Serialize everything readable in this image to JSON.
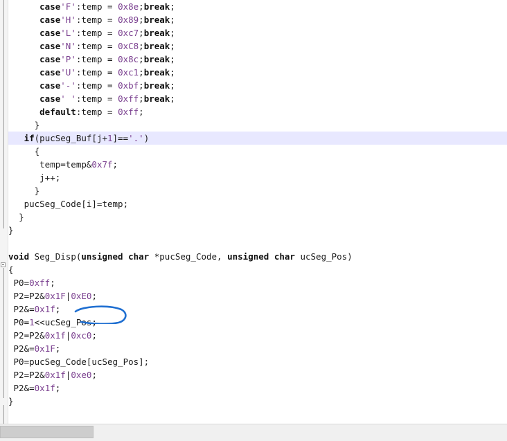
{
  "editor": {
    "lines": [
      {
        "indent": "      ",
        "parts": [
          [
            "k",
            "case"
          ],
          [
            "s",
            "'F'"
          ],
          [
            "t",
            ":temp = "
          ],
          [
            "n",
            "0x8e"
          ],
          [
            "t",
            ";"
          ],
          [
            "k",
            "break"
          ],
          [
            "t",
            ";"
          ]
        ]
      },
      {
        "indent": "      ",
        "parts": [
          [
            "k",
            "case"
          ],
          [
            "s",
            "'H'"
          ],
          [
            "t",
            ":temp = "
          ],
          [
            "n",
            "0x89"
          ],
          [
            "t",
            ";"
          ],
          [
            "k",
            "break"
          ],
          [
            "t",
            ";"
          ]
        ]
      },
      {
        "indent": "      ",
        "parts": [
          [
            "k",
            "case"
          ],
          [
            "s",
            "'L'"
          ],
          [
            "t",
            ":temp = "
          ],
          [
            "n",
            "0xc7"
          ],
          [
            "t",
            ";"
          ],
          [
            "k",
            "break"
          ],
          [
            "t",
            ";"
          ]
        ]
      },
      {
        "indent": "      ",
        "parts": [
          [
            "k",
            "case"
          ],
          [
            "s",
            "'N'"
          ],
          [
            "t",
            ":temp = "
          ],
          [
            "n",
            "0xC8"
          ],
          [
            "t",
            ";"
          ],
          [
            "k",
            "break"
          ],
          [
            "t",
            ";"
          ]
        ]
      },
      {
        "indent": "      ",
        "parts": [
          [
            "k",
            "case"
          ],
          [
            "s",
            "'P'"
          ],
          [
            "t",
            ":temp = "
          ],
          [
            "n",
            "0x8c"
          ],
          [
            "t",
            ";"
          ],
          [
            "k",
            "break"
          ],
          [
            "t",
            ";"
          ]
        ]
      },
      {
        "indent": "      ",
        "parts": [
          [
            "k",
            "case"
          ],
          [
            "s",
            "'U'"
          ],
          [
            "t",
            ":temp = "
          ],
          [
            "n",
            "0xc1"
          ],
          [
            "t",
            ";"
          ],
          [
            "k",
            "break"
          ],
          [
            "t",
            ";"
          ]
        ]
      },
      {
        "indent": "      ",
        "parts": [
          [
            "k",
            "case"
          ],
          [
            "s",
            "'-'"
          ],
          [
            "t",
            ":temp = "
          ],
          [
            "n",
            "0xbf"
          ],
          [
            "t",
            ";"
          ],
          [
            "k",
            "break"
          ],
          [
            "t",
            ";"
          ]
        ]
      },
      {
        "indent": "      ",
        "parts": [
          [
            "k",
            "case"
          ],
          [
            "s",
            "' '"
          ],
          [
            "t",
            ":temp = "
          ],
          [
            "n",
            "0xff"
          ],
          [
            "t",
            ";"
          ],
          [
            "k",
            "break"
          ],
          [
            "t",
            ";"
          ]
        ]
      },
      {
        "indent": "      ",
        "parts": [
          [
            "k",
            "default"
          ],
          [
            "t",
            ":temp = "
          ],
          [
            "n",
            "0xff"
          ],
          [
            "t",
            ";"
          ]
        ]
      },
      {
        "indent": "     ",
        "parts": [
          [
            "p",
            "}"
          ]
        ]
      },
      {
        "indent": "   ",
        "highlight": true,
        "parts": [
          [
            "k",
            "if"
          ],
          [
            "t",
            "(pucSeg_Buf[j+"
          ],
          [
            "n",
            "1"
          ],
          [
            "t",
            "]=="
          ],
          [
            "s",
            "'.'"
          ],
          [
            "t",
            ")"
          ]
        ]
      },
      {
        "indent": "     ",
        "parts": [
          [
            "p",
            "{"
          ]
        ]
      },
      {
        "indent": "      ",
        "parts": [
          [
            "t",
            "temp=temp&"
          ],
          [
            "n",
            "0x7f"
          ],
          [
            "t",
            ";"
          ]
        ]
      },
      {
        "indent": "      ",
        "parts": [
          [
            "t",
            "j++;"
          ]
        ]
      },
      {
        "indent": "     ",
        "parts": [
          [
            "p",
            "}"
          ]
        ]
      },
      {
        "indent": "   ",
        "parts": [
          [
            "t",
            "pucSeg_Code[i]=temp;"
          ]
        ]
      },
      {
        "indent": "  ",
        "parts": [
          [
            "p",
            "}"
          ]
        ]
      },
      {
        "indent": "",
        "parts": [
          [
            "p",
            "}"
          ]
        ]
      },
      {
        "indent": "",
        "parts": []
      },
      {
        "indent": "",
        "parts": [
          [
            "k",
            "void"
          ],
          [
            "t",
            " Seg_Disp("
          ],
          [
            "k",
            "unsigned char"
          ],
          [
            "t",
            " *pucSeg_Code, "
          ],
          [
            "k",
            "unsigned char"
          ],
          [
            "t",
            " ucSeg_Pos)"
          ]
        ]
      },
      {
        "indent": "",
        "parts": [
          [
            "p",
            "{"
          ]
        ]
      },
      {
        "indent": " ",
        "parts": [
          [
            "t",
            "P0="
          ],
          [
            "n",
            "0xff"
          ],
          [
            "t",
            ";"
          ]
        ]
      },
      {
        "indent": " ",
        "parts": [
          [
            "t",
            "P2=P2&"
          ],
          [
            "n",
            "0x1F"
          ],
          [
            "t",
            "|"
          ],
          [
            "n",
            "0xE0"
          ],
          [
            "t",
            ";"
          ]
        ]
      },
      {
        "indent": " ",
        "parts": [
          [
            "t",
            "P2&="
          ],
          [
            "n",
            "0x1f"
          ],
          [
            "t",
            ";"
          ]
        ]
      },
      {
        "indent": " ",
        "parts": [
          [
            "t",
            "P0="
          ],
          [
            "n",
            "1"
          ],
          [
            "t",
            "<<ucSeg_Pos;"
          ]
        ]
      },
      {
        "indent": " ",
        "parts": [
          [
            "t",
            "P2=P2&"
          ],
          [
            "n",
            "0x1f"
          ],
          [
            "t",
            "|"
          ],
          [
            "n",
            "0xc0"
          ],
          [
            "t",
            ";"
          ]
        ]
      },
      {
        "indent": " ",
        "parts": [
          [
            "t",
            "P2&="
          ],
          [
            "n",
            "0x1F"
          ],
          [
            "t",
            ";"
          ]
        ]
      },
      {
        "indent": " ",
        "parts": [
          [
            "t",
            "P0=pucSeg_Code[ucSeg_Pos];"
          ]
        ]
      },
      {
        "indent": " ",
        "parts": [
          [
            "t",
            "P2=P2&"
          ],
          [
            "n",
            "0x1f"
          ],
          [
            "t",
            "|"
          ],
          [
            "n",
            "0xe0"
          ],
          [
            "t",
            ";"
          ]
        ]
      },
      {
        "indent": " ",
        "parts": [
          [
            "t",
            "P2&="
          ],
          [
            "n",
            "0x1f"
          ],
          [
            "t",
            ";"
          ]
        ]
      },
      {
        "indent": "",
        "parts": [
          [
            "p",
            "}"
          ]
        ]
      }
    ]
  },
  "colors": {
    "keyword": "#111111",
    "number": "#7a3f8f",
    "highlight_line": "#e8e8ff",
    "annotation_circle": "#1f6fd1"
  }
}
